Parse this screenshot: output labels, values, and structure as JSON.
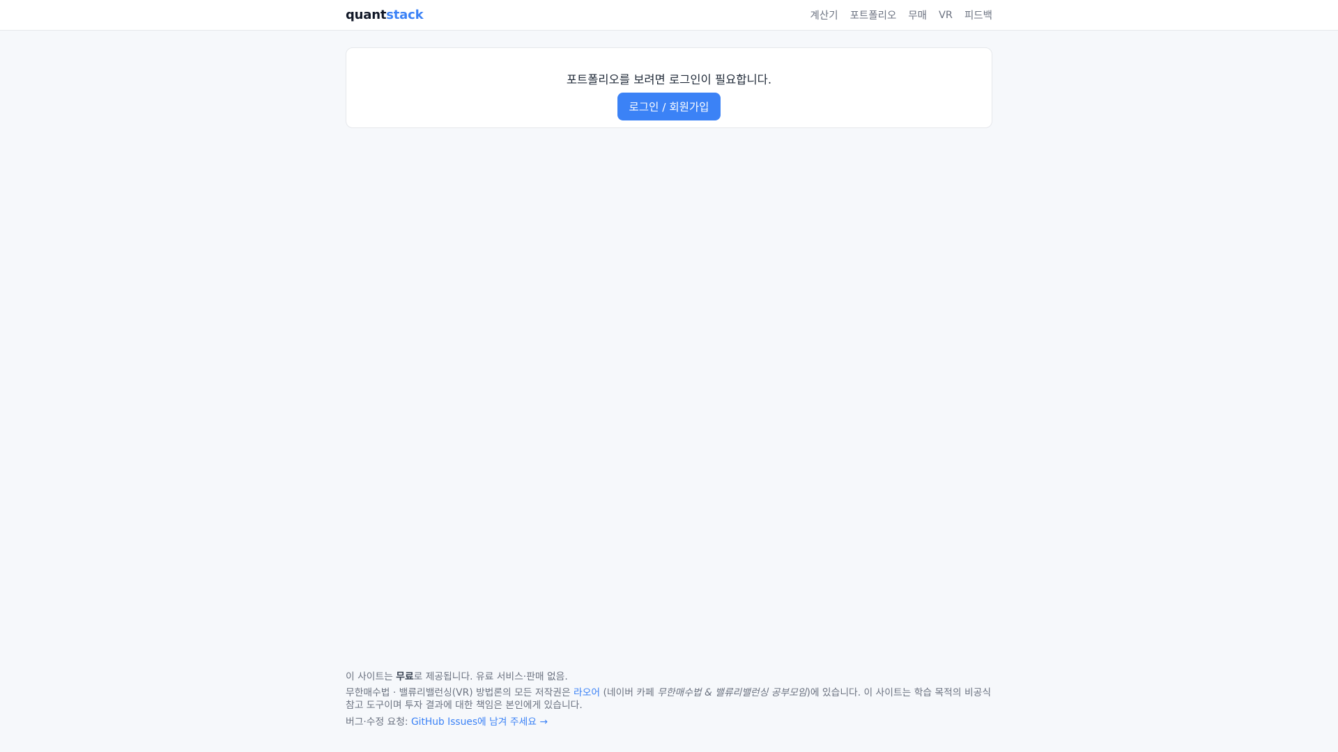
{
  "header": {
    "logo_part1": "quant",
    "logo_part2": "stack",
    "nav": [
      {
        "label": "계산기"
      },
      {
        "label": "포트폴리오"
      },
      {
        "label": "무매"
      },
      {
        "label": "VR"
      },
      {
        "label": "피드백"
      }
    ]
  },
  "main": {
    "login_message": "포트폴리오를 보려면 로그인이 필요합니다.",
    "login_button": "로그인 / 회원가입"
  },
  "footer": {
    "line1_a": "이 사이트는 ",
    "line1_b": "무료",
    "line1_c": "로 제공됩니다. 유료 서비스·판매 없음.",
    "line2_a": "무한매수법 · 밸류리밸런싱(VR) 방법론의 모든 저작권은 ",
    "line2_link": "라오어",
    "line2_b": " (네이버 카페 ",
    "line2_cafe": "무한매수법 & 밸류리밸런싱 공부모임",
    "line2_c": ")에 있습니다. 이 사이트는 학습 목적의 비공식 참고 도구이며 투자 결과에 대한 책임은 본인에게 있습니다.",
    "line3_a": "버그·수정 요청: ",
    "line3_link": "GitHub Issues에 남겨 주세요 →"
  },
  "colors": {
    "accent": "#3b82f6",
    "background": "#f6f8fb",
    "text": "#1f2937",
    "muted": "#6b7280"
  }
}
